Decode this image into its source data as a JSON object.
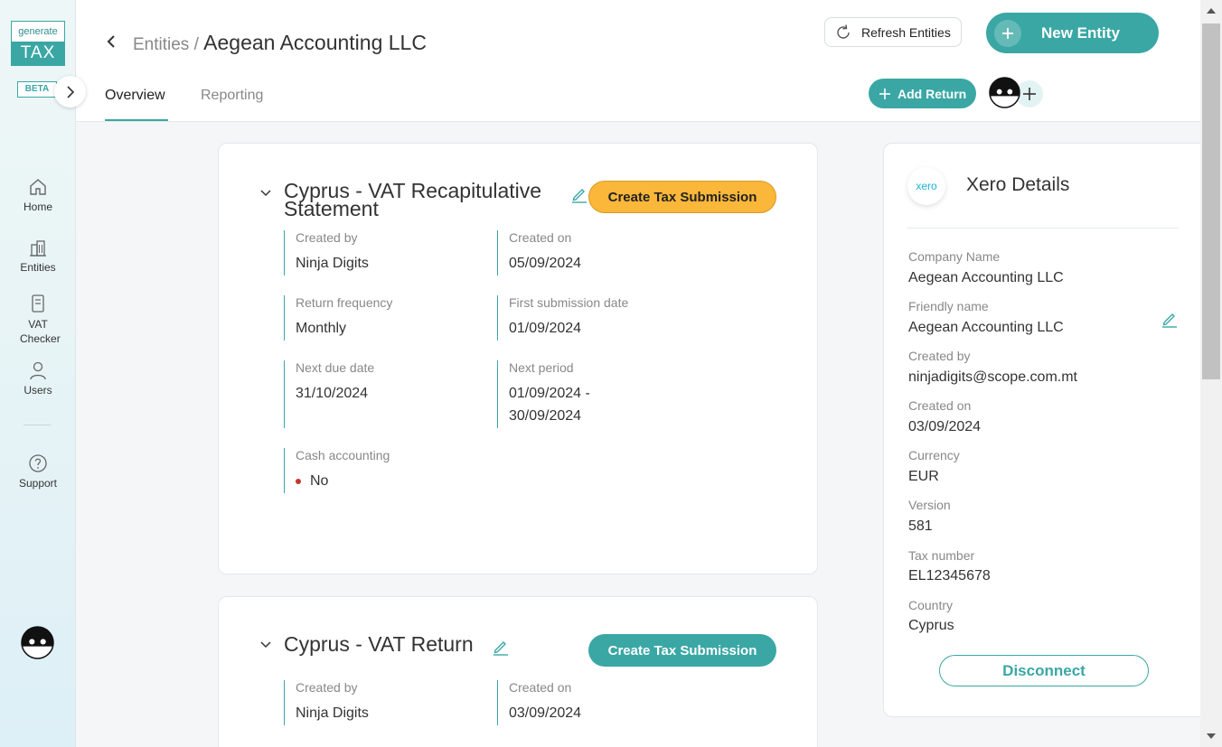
{
  "sidebar": {
    "logo_top": "generate",
    "logo_bottom": "TAX",
    "beta": "BETA",
    "items": [
      {
        "label": "Home"
      },
      {
        "label": "Entities"
      },
      {
        "label": "VAT Checker"
      },
      {
        "label": "Users"
      },
      {
        "label": "Support"
      }
    ]
  },
  "header": {
    "breadcrumb_parent": "Entities",
    "breadcrumb_sep": "/",
    "title": "Aegean Accounting LLC",
    "tabs": [
      {
        "label": "Overview",
        "active": true
      },
      {
        "label": "Reporting",
        "active": false
      }
    ],
    "refresh_label": "Refresh Entities",
    "new_entity_label": "New Entity",
    "add_return_label": "Add Return"
  },
  "returns": [
    {
      "title_line1": "Cyprus - VAT Recapitulative",
      "title_line2": "Statement",
      "button": "Create Tax Submission",
      "button_color": "#fbb73a",
      "fields": [
        {
          "label": "Created by",
          "value": "Ninja Digits"
        },
        {
          "label": "Created on",
          "value": "05/09/2024"
        },
        {
          "label": "Return frequency",
          "value": "Monthly"
        },
        {
          "label": "First submission date",
          "value": "01/09/2024"
        },
        {
          "label": "Next due date",
          "value": "31/10/2024"
        },
        {
          "label": "Next period",
          "value_line1": "01/09/2024 -",
          "value_line2": "30/09/2024"
        },
        {
          "label": "Cash accounting",
          "value": "No"
        }
      ]
    },
    {
      "title_line1": "Cyprus - VAT Return",
      "button": "Create Tax Submission",
      "button_color": "#3aa7a5",
      "fields": [
        {
          "label": "Created by",
          "value": "Ninja Digits"
        },
        {
          "label": "Created on",
          "value": "03/09/2024"
        }
      ]
    }
  ],
  "xero": {
    "logo_text": "xero",
    "title": "Xero Details",
    "fields": [
      {
        "label": "Company Name",
        "value": "Aegean Accounting LLC"
      },
      {
        "label": "Friendly name",
        "value": "Aegean Accounting LLC"
      },
      {
        "label": "Created by",
        "value": "ninjadigits@scope.com.mt"
      },
      {
        "label": "Created on",
        "value": "03/09/2024"
      },
      {
        "label": "Currency",
        "value": "EUR"
      },
      {
        "label": "Version",
        "value": "581"
      },
      {
        "label": "Tax number",
        "value": "EL12345678"
      },
      {
        "label": "Country",
        "value": "Cyprus"
      }
    ],
    "disconnect_label": "Disconnect"
  },
  "colors": {
    "accent": "#3aa7a5",
    "warning_button": "#fbb73a",
    "status_no": "#c0392b"
  }
}
